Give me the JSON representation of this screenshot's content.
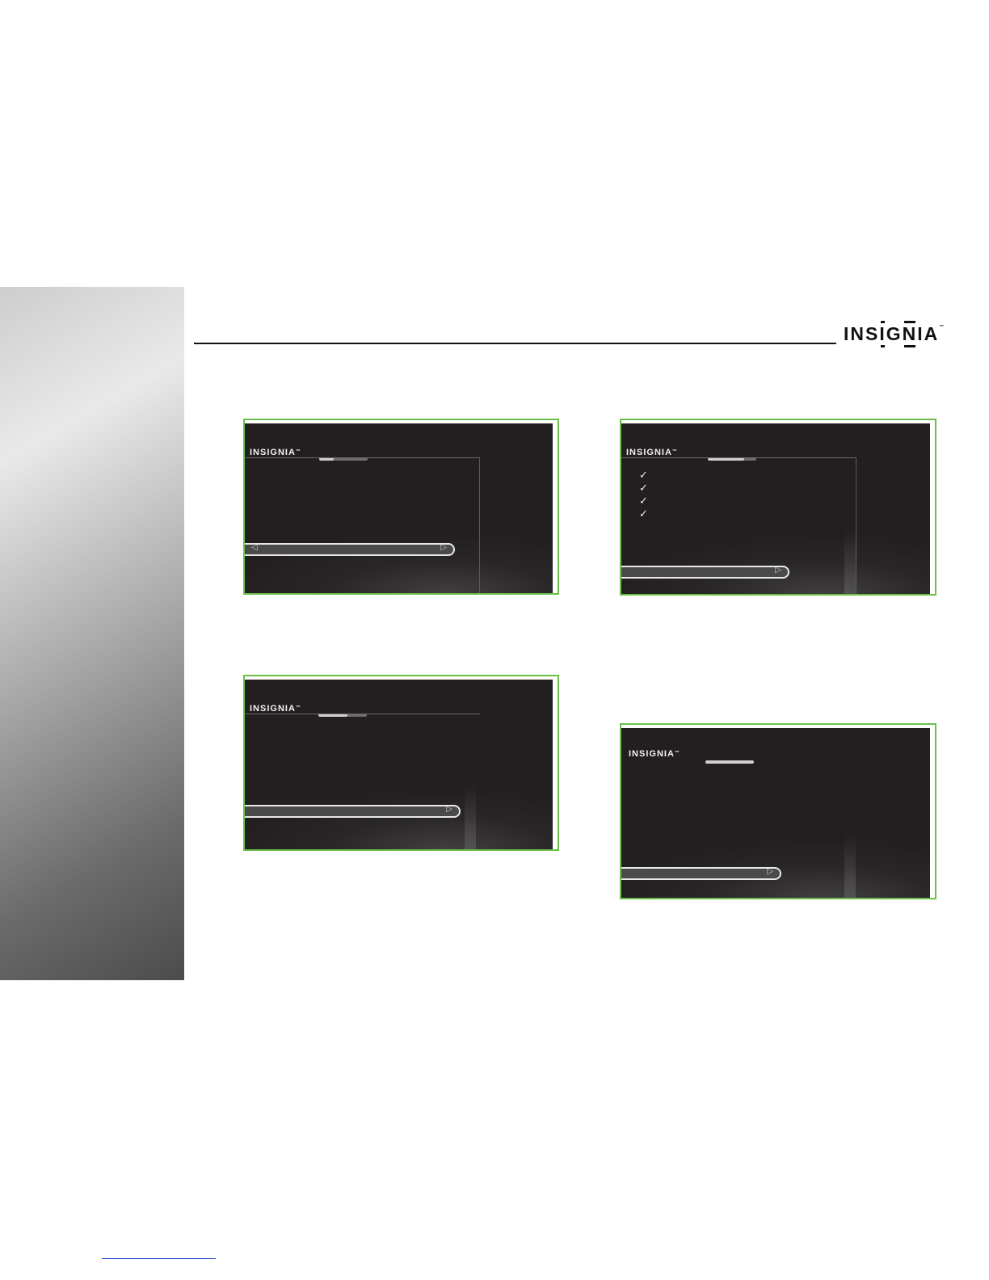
{
  "header": {
    "brand": "INSIGNIA",
    "brand_trademark": "™"
  },
  "colors": {
    "frame_border": "#6abf4b",
    "screen_bg": "#231f20",
    "rule": "#111111"
  },
  "screenshots": [
    {
      "logo": "INSIGNIA",
      "trademark": "™",
      "progress_fraction": 0.3,
      "left_arrow": "◁",
      "right_arrow": "▷"
    },
    {
      "logo": "INSIGNIA",
      "trademark": "™",
      "progress_fraction": 0.75,
      "checks": [
        "✓",
        "✓",
        "✓",
        "✓"
      ],
      "right_arrow": "▷"
    },
    {
      "logo": "INSIGNIA",
      "trademark": "™",
      "progress_fraction": 0.6,
      "right_arrow": "▷"
    },
    {
      "logo": "INSIGNIA",
      "trademark": "™",
      "progress_fraction": 1.0,
      "right_arrow": "▷"
    }
  ]
}
